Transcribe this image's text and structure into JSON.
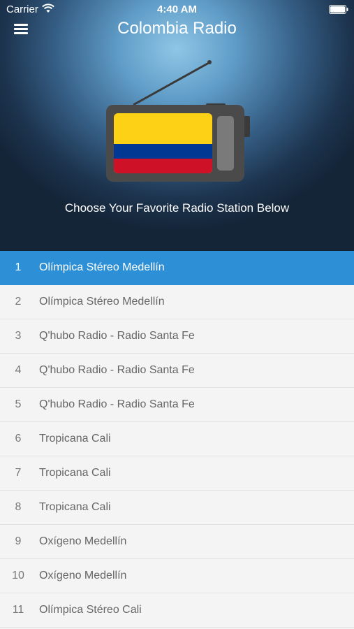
{
  "status_bar": {
    "carrier": "Carrier",
    "time": "4:40 AM"
  },
  "header": {
    "title": "Colombia Radio",
    "menu_icon": "hamburger-menu-icon"
  },
  "hero": {
    "illustration": "radio-with-colombia-flag",
    "tagline": "Choose Your Favorite Radio Station Below"
  },
  "colors": {
    "active_row": "#2d8fd5",
    "flag_yellow": "#fcd116",
    "flag_blue": "#003893",
    "flag_red": "#ce1126"
  },
  "stations": [
    {
      "number": "1",
      "name": "Olímpica Stéreo Medellín",
      "selected": true
    },
    {
      "number": "2",
      "name": "Olímpica Stéreo Medellín"
    },
    {
      "number": "3",
      "name": "Q'hubo Radio - Radio Santa Fe"
    },
    {
      "number": "4",
      "name": "Q'hubo Radio - Radio Santa Fe"
    },
    {
      "number": "5",
      "name": "Q'hubo Radio - Radio Santa Fe"
    },
    {
      "number": "6",
      "name": "Tropicana Cali"
    },
    {
      "number": "7",
      "name": "Tropicana Cali"
    },
    {
      "number": "8",
      "name": "Tropicana Cali"
    },
    {
      "number": "9",
      "name": "Oxígeno Medellín"
    },
    {
      "number": "10",
      "name": "Oxígeno Medellín"
    },
    {
      "number": "11",
      "name": "Olímpica Stéreo Cali"
    }
  ]
}
